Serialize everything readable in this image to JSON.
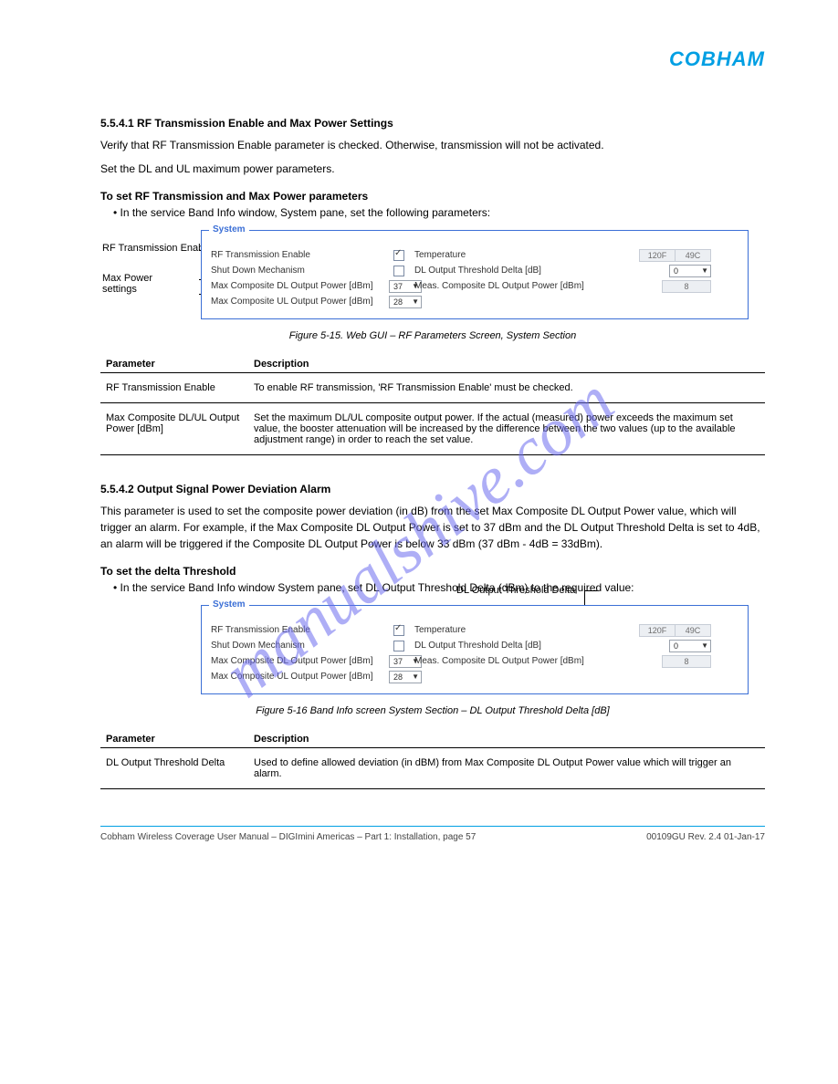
{
  "brand": "COBHAM",
  "watermark": "manualshive.com",
  "intro": {
    "h1": "5.5.4.1   RF Transmission Enable and Max Power Settings",
    "p1": "Verify that RF Transmission Enable parameter is checked. Otherwise, transmission will not be activated.",
    "p2": "Set the DL and UL maximum power parameters.",
    "todo": "To set RF Transmission and Max Power parameters",
    "li": "In the service Band Info window, System pane, set the following parameters:",
    "caption": "Figure 5-15. Web GUI – RF Parameters Screen, System Section",
    "fig_labels": {
      "rf": "RF Transmission Enable",
      "max": "Max Power\nsettings",
      "dl": "DL Output Threshold Delta"
    }
  },
  "second": {
    "h1": "5.5.4.2   Output Signal Power Deviation Alarm",
    "p1": "This parameter is used to set the composite power deviation (in dB) from the set Max Composite DL Output Power value, which will trigger an alarm. For example, if the Max Composite DL Output Power is set to 37 dBm and the DL Output Threshold Delta is set to 4dB, an alarm will be triggered if the Composite DL Output Power is below 33 dBm (37 dBm - 4dB = 33dBm).",
    "todo": "To set the delta Threshold",
    "li": "In the service Band Info window System pane, set DL Output Threshold Delta (dBm) to the required value:",
    "caption": "Figure 5-16 Band Info screen System Section – DL Output Threshold Delta [dB]"
  },
  "sys": {
    "legend": "System",
    "rf_enable": "RF Transmission Enable",
    "shutdown": "Shut Down Mechanism",
    "max_dl": "Max Composite DL Output Power [dBm]",
    "max_ul": "Max Composite UL Output Power [dBm]",
    "dl_val": "37",
    "ul_val": "28",
    "temperature": "Temperature",
    "dl_thresh": "DL Output Threshold Delta [dB]",
    "meas_dl": "Meas. Composite DL Output Power [dBm]",
    "temp_f": "120F",
    "temp_c": "49C",
    "thresh_val": "0",
    "meas_val": "8",
    "rf_checked": true,
    "shutdown_checked": false
  },
  "table1": {
    "h_param": "Parameter",
    "h_desc": "Description",
    "rows": [
      {
        "p": "RF Transmission Enable",
        "d": "To enable RF transmission, 'RF Transmission Enable' must be checked."
      },
      {
        "p": "Max Composite DL/UL Output Power [dBm]",
        "d": "Set the maximum DL/UL composite output power. If the actual (measured) power exceeds the maximum set value, the booster attenuation will be increased by the difference between the two values (up to the available adjustment range) in order to reach the set value."
      }
    ]
  },
  "table2": {
    "h_param": "Parameter",
    "h_desc": "Description",
    "rows": [
      {
        "p": "DL Output Threshold Delta",
        "d": "Used to define allowed deviation (in dBM) from Max Composite DL Output Power value which will trigger an alarm."
      }
    ]
  },
  "footer": {
    "left": "Cobham Wireless Coverage User Manual – DIGImini Americas – Part 1: Installation, page 57",
    "right": "00109GU Rev. 2.4 01-Jan-17"
  }
}
